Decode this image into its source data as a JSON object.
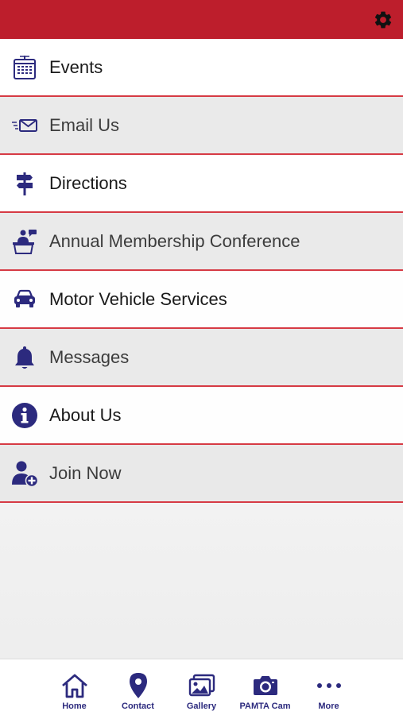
{
  "header": {
    "settings_icon": "gear-icon",
    "bar_color": "#bd1e2c"
  },
  "menu": {
    "items": [
      {
        "label": "Events",
        "icon": "calendar-icon"
      },
      {
        "label": "Email Us",
        "icon": "email-icon"
      },
      {
        "label": "Directions",
        "icon": "signpost-icon"
      },
      {
        "label": "Annual Membership Conference",
        "icon": "conference-speaker-icon"
      },
      {
        "label": "Motor Vehicle Services",
        "icon": "car-icon"
      },
      {
        "label": "Messages",
        "icon": "bell-icon"
      },
      {
        "label": "About Us",
        "icon": "info-icon"
      },
      {
        "label": "Join Now",
        "icon": "add-user-icon"
      }
    ],
    "divider_color": "#d63a44",
    "icon_color": "#2c2a7e"
  },
  "tabbar": {
    "tabs": [
      {
        "label": "Home",
        "icon": "home-icon"
      },
      {
        "label": "Contact",
        "icon": "map-pin-icon"
      },
      {
        "label": "Gallery",
        "icon": "gallery-icon"
      },
      {
        "label": "PAMTA Cam",
        "icon": "camera-icon"
      },
      {
        "label": "More",
        "icon": "more-icon"
      }
    ]
  }
}
